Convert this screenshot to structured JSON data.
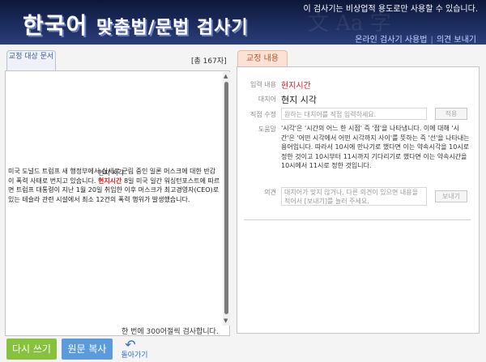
{
  "header": {
    "title_main": "한국어 ",
    "title_rest": "맞춤법/문법 검사기",
    "notice": "이 검사기는 비상업적 용도로만 사용할 수 있습니다.",
    "links": [
      "온라인 검사기 사용법",
      "의견 보내기"
    ]
  },
  "left": {
    "tab_label": "교정 대상 문서",
    "char_count": "[총 167자]",
    "paragraphs": {
      "p1": "미국 도널드 트럼프 새 행정부에서 실세로 군림 중인 일론 머스크에 대한 반감이 폭력 사태로 번지고 있습니다.",
      "p1_highlight": "현지시간",
      "p1_highlight_note": "현지 시각",
      "p1_after": " 8일 미국 일간 워싱턴포스트에 따르면 트럼프 대통령이 지난 1월 20일 취임한 이후 머스크가 최고경영자(CEO)로 있는 테슬라 관련 시설에서 최소 12건의 폭력 행위가 발생했습니다."
    },
    "limit_text": "한 번에 300어절씩 검사합니다."
  },
  "right": {
    "tab_label": "교정 내용",
    "input_label": "입력 내용",
    "input_value": "현지시간",
    "alt_label": "대치어",
    "alt_value": "현지 시각",
    "direct_label": "직접 수정",
    "direct_placeholder": "원하는 대치어를 직접 입력하세요.",
    "apply_button": "적용",
    "help_label": "도움말",
    "help_text": "'시각'은 '시간의 어느 한 시점' 즉 '점'을 나타냅니다. 이에 대해 '시간'은 '어떤 시각에서 어떤 시각까지 사이'를 뜻하는 즉 '선'을 나타내는 용어입니다. 따라서 10시에 만나기로 했다면 이는 약속시각을 10시로 정한 것이고 10시부터 11시까지 기다리기로 했다면 이는 약속시간을 10시에서 11시로 정한 것입니다.",
    "opinion_label": "의견",
    "opinion_placeholder": "대치어가 맞지 않거나, 다른 의견이 있으면 내용을 적어서 [보내기]를 눌러 주세요.",
    "send_button": "보내기"
  },
  "buttons": {
    "rewrite": "다시 쓰기",
    "copy": "원문 복사",
    "back": "돌아가기"
  }
}
